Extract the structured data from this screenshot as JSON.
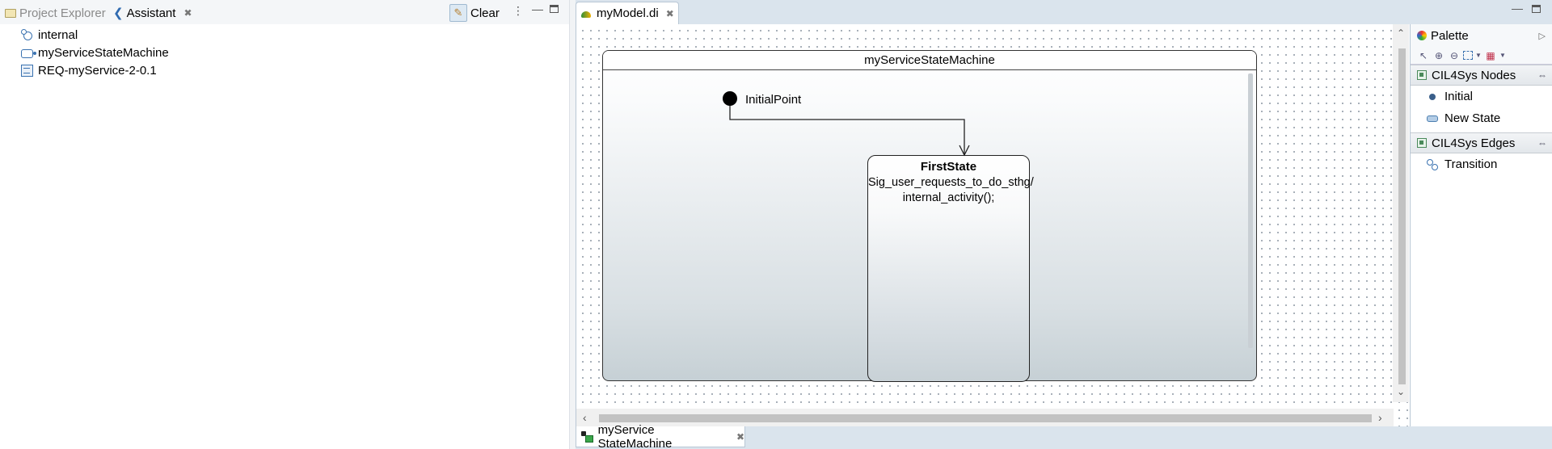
{
  "left_panel": {
    "tabs": [
      {
        "label": "Project Explorer",
        "icon": "folder-icon",
        "active": false
      },
      {
        "label": "Assistant",
        "icon": "assistant-icon",
        "active": true
      }
    ],
    "clear_label": "Clear",
    "tree": [
      {
        "label": "internal",
        "icon": "internal-icon"
      },
      {
        "label": "myServiceStateMachine",
        "icon": "state-machine-icon"
      },
      {
        "label": "REQ-myService-2-0.1",
        "icon": "requirement-icon"
      }
    ]
  },
  "editor": {
    "tab_label": "myModel.di",
    "bottom_tab_label": "myService StateMachine",
    "diagram": {
      "state_machine_name": "myServiceStateMachine",
      "initial_label": "InitialPoint",
      "first_state": {
        "name": "FirstState",
        "line1": "Sig_user_requests_to_do_sthg/",
        "line2": "internal_activity();"
      }
    }
  },
  "palette": {
    "title": "Palette",
    "drawers": [
      {
        "label": "CIL4Sys Nodes",
        "items": [
          {
            "label": "Initial",
            "icon": "initial-icon"
          },
          {
            "label": "New State",
            "icon": "state-icon"
          }
        ]
      },
      {
        "label": "CIL4Sys Edges",
        "items": [
          {
            "label": "Transition",
            "icon": "transition-icon"
          }
        ]
      }
    ]
  },
  "colors": {
    "editor_bg": "#dae4ed",
    "tab_bar_bg": "#f4f6f8",
    "accent_icon": "#3a72b0"
  }
}
